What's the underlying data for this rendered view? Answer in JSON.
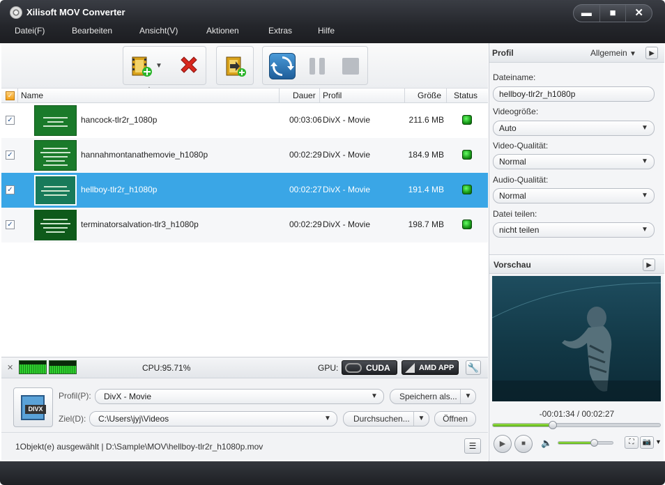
{
  "app": {
    "title": "Xilisoft MOV Converter"
  },
  "menu": [
    "Datei(F)",
    "Bearbeiten",
    "Ansicht(V)",
    "Aktionen",
    "Extras",
    "Hilfe"
  ],
  "window_controls": {
    "minimize": "▬",
    "maximize": "■",
    "close": "✕"
  },
  "columns": {
    "name": "Name",
    "duration": "Dauer",
    "profile": "Profil",
    "size": "Größe",
    "status": "Status"
  },
  "files": [
    {
      "name": "hancock-tlr2r_1080p",
      "duration": "00:03:06",
      "profile": "DivX - Movie",
      "size": "211.6 MB",
      "checked": true
    },
    {
      "name": "hannahmontanathemovie_h1080p",
      "duration": "00:02:29",
      "profile": "DivX - Movie",
      "size": "184.9 MB",
      "checked": true
    },
    {
      "name": "hellboy-tlr2r_h1080p",
      "duration": "00:02:27",
      "profile": "DivX - Movie",
      "size": "191.4 MB",
      "checked": true
    },
    {
      "name": "terminatorsalvation-tlr3_h1080p",
      "duration": "00:02:29",
      "profile": "DivX - Movie",
      "size": "198.7 MB",
      "checked": true
    }
  ],
  "cpu": {
    "label": "CPU:95.71%"
  },
  "gpu": {
    "label": "GPU:",
    "cuda": "CUDA",
    "amd": "AMD APP"
  },
  "bottom": {
    "profile_label": "Profil(P):",
    "profile_value": "DivX - Movie",
    "save_as": "Speichern als...",
    "dest_label": "Ziel(D):",
    "dest_value": "C:\\Users\\jyj\\Videos",
    "browse": "Durchsuchen...",
    "open": "Öffnen",
    "divx_badge": "DIVX"
  },
  "status_text": "1Objekt(e) ausgewählt | D:\\Sample\\MOV\\hellboy-tlr2r_h1080p.mov",
  "panel": {
    "header": "Profil",
    "mode": "Allgemein",
    "filename_label": "Dateiname:",
    "filename_value": "hellboy-tlr2r_h1080p",
    "videosize_label": "Videogröße:",
    "videosize_value": "Auto",
    "videoquality_label": "Video-Qualität:",
    "videoquality_value": "Normal",
    "audioquality_label": "Audio-Qualität:",
    "audioquality_value": "Normal",
    "split_label": "Datei teilen:",
    "split_value": "nicht teilen"
  },
  "preview": {
    "header": "Vorschau",
    "time": "-00:01:34 / 00:02:27",
    "progress": 0.36,
    "volume": 0.67
  },
  "colors": {
    "selection": "#3aa6e6",
    "status_ok": "#22b022",
    "titlebar": "#2a2c31"
  }
}
